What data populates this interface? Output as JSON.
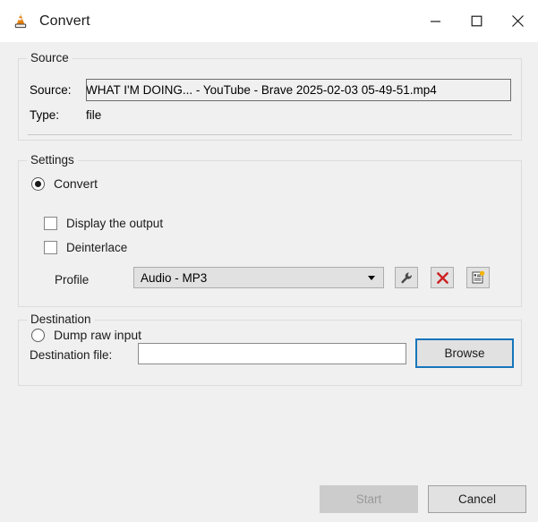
{
  "window": {
    "title": "Convert",
    "app_icon": "vlc-cone-icon",
    "controls": {
      "minimize": "minimize-icon",
      "maximize": "maximize-icon",
      "close": "close-icon"
    }
  },
  "source": {
    "group_title": "Source",
    "source_label": "Source:",
    "source_value": "WHAT I'M DOING... - YouTube - Brave 2025-02-03 05-49-51.mp4",
    "type_label": "Type:",
    "type_value": "file"
  },
  "settings": {
    "group_title": "Settings",
    "convert_radio": {
      "label": "Convert",
      "selected": true
    },
    "display_output_checkbox": {
      "label": "Display the output",
      "checked": false
    },
    "deinterlace_checkbox": {
      "label": "Deinterlace",
      "checked": false
    },
    "profile_label": "Profile",
    "profile_value": "Audio - MP3",
    "profile_buttons": {
      "edit": "wrench-icon",
      "delete": "red-x-icon",
      "create": "new-profile-icon"
    },
    "dump_radio": {
      "label": "Dump raw input",
      "selected": false
    }
  },
  "destination": {
    "group_title": "Destination",
    "file_label": "Destination file:",
    "file_value": "",
    "browse_label": "Browse"
  },
  "footer": {
    "start_label": "Start",
    "start_enabled": false,
    "cancel_label": "Cancel"
  },
  "colors": {
    "dialog_bg": "#f0f0f0",
    "titlebar_bg": "#ffffff",
    "accent_focus": "#1675bb",
    "delete_red": "#cc2222",
    "vlc_orange": "#e8820c",
    "disabled_text": "#9a9a9a"
  }
}
